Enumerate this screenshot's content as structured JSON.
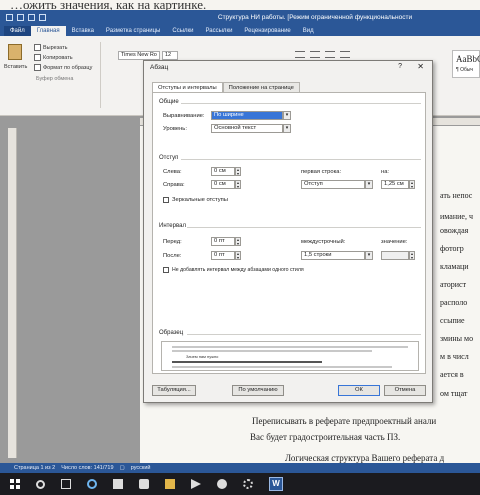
{
  "caption": "…ожить значения, как на картинке.",
  "window": {
    "title": "Структура НИ работы. [Режим ограниченной функциональности"
  },
  "ribbon_tabs": [
    "Файл",
    "Главная",
    "Вставка",
    "Разметка страницы",
    "Ссылки",
    "Рассылки",
    "Рецензирование",
    "Вид"
  ],
  "ribbon": {
    "cut": "Вырезать",
    "copy": "Копировать",
    "format_painter": "Формат по образцу",
    "paste": "Вставить",
    "clipboard_group": "Буфер обмена",
    "font_name": "Times New Ro",
    "font_size": "12",
    "style_sample": "AaBbC",
    "style_name": "¶ Обыч"
  },
  "document": {
    "right_fragments": [
      "ать непос",
      "имание, ч",
      "овождая",
      "фотогр",
      "кламаци",
      "аторист",
      "располо",
      "ссыпие",
      "змины мо",
      "м в числ",
      "ается в",
      "ом тщат"
    ],
    "line1": "Переписывать в реферате предпроектный анали",
    "line2": "Вас будет градостроительная часть ПЗ.",
    "line3": "Логическая структура Вашего реферата д"
  },
  "statusbar": {
    "page": "Страница 1 из 2",
    "words": "Число слов: 141/719",
    "language": "русский"
  },
  "dialog": {
    "title": "Абзац",
    "help": "?",
    "close": "✕",
    "tabs": [
      "Отступы и интервалы",
      "Положение на странице"
    ],
    "general": {
      "heading": "Общие",
      "alignment_label": "Выравнивание:",
      "alignment_value": "По ширине",
      "level_label": "Уровень:",
      "level_value": "Основной текст"
    },
    "indent": {
      "heading": "Отступ",
      "left_label": "Слева:",
      "left_value": "0 см",
      "right_label": "Справа:",
      "right_value": "0 см",
      "first_line_label": "первая строка:",
      "first_line_value": "Отступ",
      "by_label": "на:",
      "by_value": "1,25 см",
      "mirror_label": "Зеркальные отступы"
    },
    "spacing": {
      "heading": "Интервал",
      "before_label": "Перед:",
      "before_value": "0 пт",
      "after_label": "После:",
      "after_value": "0 пт",
      "line_label": "междустрочный:",
      "line_value": "1,5 строки",
      "at_label": "значение:",
      "at_value": "",
      "no_space_label": "Не добавлять интервал между абзацами одного стиля"
    },
    "preview": {
      "heading": "Образец",
      "sample": "Зачем нам нужно"
    },
    "buttons": {
      "tabs": "Табуляция...",
      "default": "По умолчанию",
      "ok": "ОК",
      "cancel": "Отмена"
    }
  }
}
